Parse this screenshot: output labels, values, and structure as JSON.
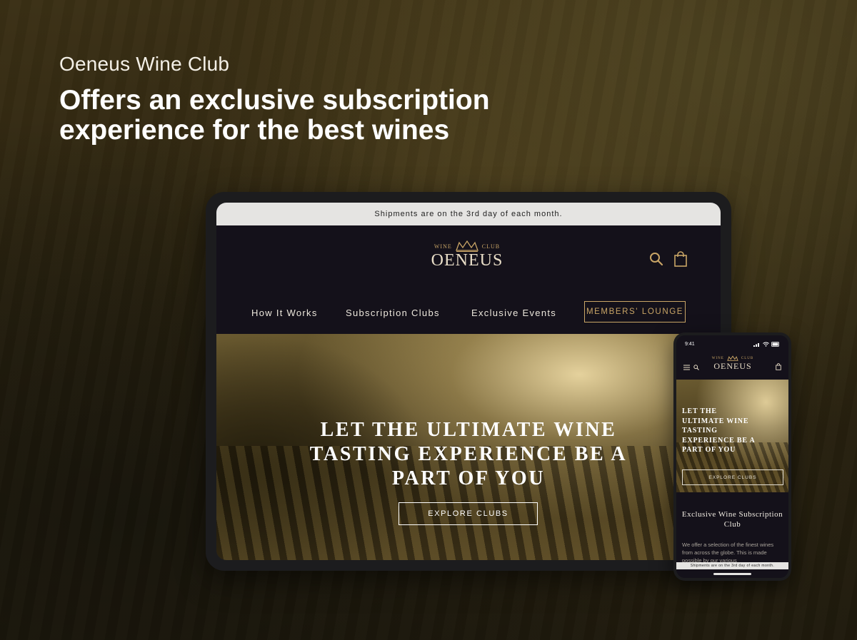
{
  "intro": {
    "label": "Oeneus Wine Club",
    "headline": "Offers an exclusive subscription experience for the best wines"
  },
  "tablet": {
    "announcement": "Shipments are on the 3rd day of each month.",
    "logo": {
      "small_left": "WINE",
      "small_right": "CLUB",
      "word": "OENEUS"
    },
    "icons": [
      "search-icon",
      "shopping-bag-icon"
    ],
    "nav": {
      "items": [
        "How It Works",
        "Subscription Clubs",
        "Exclusive Events"
      ],
      "members_button": "MEMBERS' LOUNGE"
    },
    "hero": {
      "title": "LET THE ULTIMATE WINE TASTING EXPERIENCE BE A PART OF YOU",
      "cta": "EXPLORE CLUBS"
    }
  },
  "phone": {
    "time": "9:41",
    "logo": {
      "small_left": "WINE",
      "small_right": "CLUB",
      "word": "OENEUS"
    },
    "icons": [
      "hamburger-menu-icon",
      "search-icon",
      "shopping-bag-icon"
    ],
    "hero": {
      "title": "LET THE ULTIMATE WINE TASTING EXPERIENCE BE A PART OF YOU",
      "cta": "EXPLORE CLUBS"
    },
    "section_title": "Exclusive Wine Subscription Club",
    "body": "We offer a selection of the finest wines from across the globe. This is made possible by our various",
    "announcement": "Shipments are on the 3rd day of each month."
  },
  "colors": {
    "gold": "#c9a566",
    "dark": "#14111a",
    "announce_bg": "#e5e4e2"
  }
}
